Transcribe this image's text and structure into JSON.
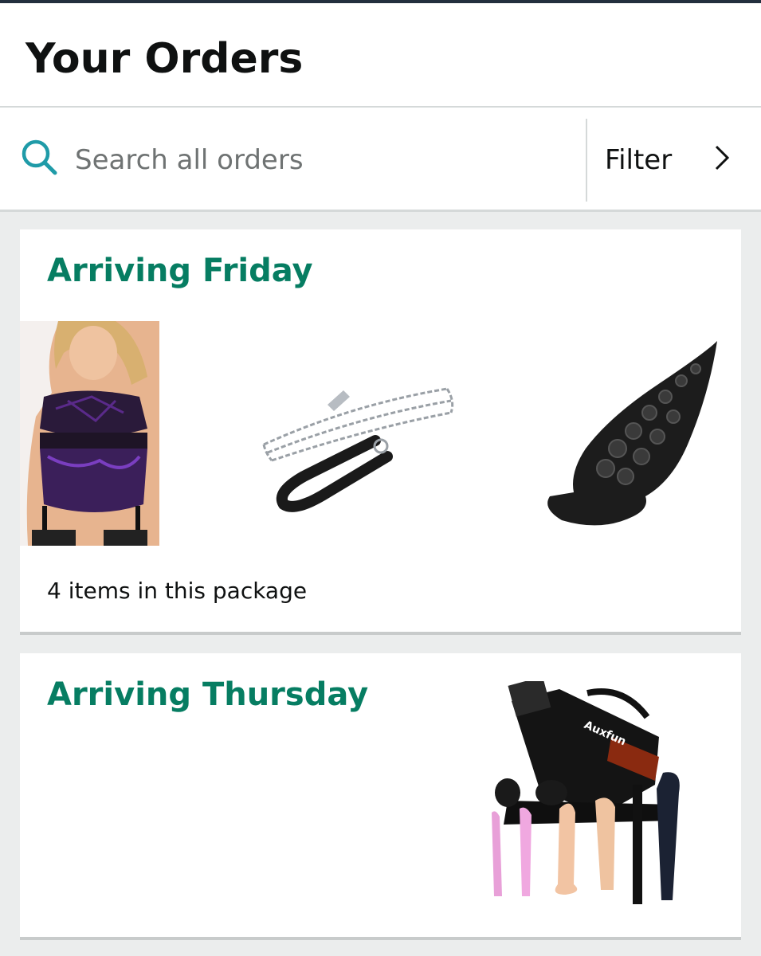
{
  "header": {
    "title": "Your Orders"
  },
  "search": {
    "placeholder": "Search all orders",
    "value": "",
    "icon": "search-icon"
  },
  "filter": {
    "label": "Filter",
    "icon": "chevron-right-icon"
  },
  "colors": {
    "accent": "#067d62",
    "search_icon": "#1f9ba8",
    "text": "#0f1111",
    "background": "#ebeded"
  },
  "orders": [
    {
      "status": "Arriving Friday",
      "items_summary": "4 items in this package",
      "items": [
        {
          "image": "lingerie-set"
        },
        {
          "image": "chain-leash"
        },
        {
          "image": "black-tentacle-toy"
        }
      ]
    },
    {
      "status": "Arriving Thursday",
      "items": [
        {
          "image": "machine-with-attachments",
          "brand_text": "Auxfun"
        }
      ]
    }
  ]
}
